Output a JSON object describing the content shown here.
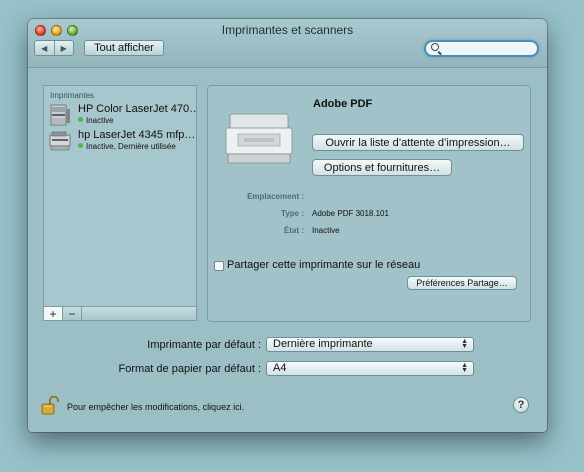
{
  "window": {
    "title": "Imprimantes et scanners"
  },
  "toolbar": {
    "back_glyph": "◀",
    "forward_glyph": "▶",
    "show_all_label": "Tout afficher",
    "search_placeholder": ""
  },
  "printer_list": {
    "header": "Imprimantes",
    "items": [
      {
        "name": "HP Color LaserJet 470…",
        "status": "Inactive",
        "status_color": "#4fb648"
      },
      {
        "name": "hp LaserJet 4345 mfp…",
        "status": "Inactive, Dernière utilisée",
        "status_color": "#4fb648"
      }
    ],
    "add_label": "+",
    "remove_label": "−"
  },
  "detail": {
    "printer_name": "Adobe PDF",
    "open_queue_label": "Ouvrir la liste d’attente d’impression…",
    "options_label": "Options et fournitures…",
    "location_label": "Emplacement :",
    "location_value": "",
    "type_label": "Type :",
    "type_value": "Adobe PDF 3018.101",
    "state_label": "État :",
    "state_value": "Inactive",
    "share_label": "Partager cette imprimante sur le réseau",
    "share_checked": false,
    "sharing_prefs_label": "Préférences Partage…"
  },
  "defaults": {
    "default_printer_label": "Imprimante par défaut :",
    "default_printer_value": "Dernière imprimante",
    "paper_size_label": "Format de papier par défaut :",
    "paper_size_value": "A4"
  },
  "footer": {
    "lock_text": "Pour empêcher les modifications, cliquez ici.",
    "help_label": "?"
  },
  "icons": {
    "lock": "lock-open-icon",
    "search": "search-icon",
    "help": "help-icon"
  }
}
